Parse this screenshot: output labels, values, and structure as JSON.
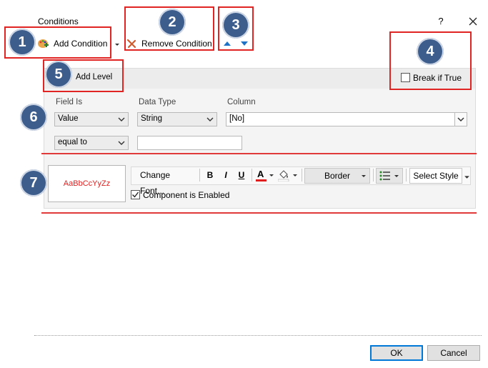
{
  "window": {
    "title": "Conditions",
    "help_label": "?",
    "close_icon": "close-icon"
  },
  "toolbar": {
    "add_condition_label": "Add Condition",
    "remove_condition_label": "Remove Condition",
    "add_icon": "palette-add-icon",
    "remove_icon": "remove-x-icon",
    "move_up_icon": "arrow-up-icon",
    "move_down_icon": "arrow-down-icon"
  },
  "badges": [
    "1",
    "2",
    "3",
    "4",
    "5",
    "6",
    "7"
  ],
  "level": {
    "add_level_label": "Add Level",
    "break_if_true_label": "Break if True",
    "break_if_true_checked": false
  },
  "condition": {
    "field_is_label": "Field Is",
    "data_type_label": "Data Type",
    "column_label": "Column",
    "field_is_value": "Value",
    "data_type_value": "String",
    "column_value": "[No]",
    "operator_value": "equal to",
    "compare_value": ""
  },
  "format": {
    "preview_text": "AaBbCcYyZz",
    "change_font_label": "Change Font...",
    "bold_label": "B",
    "italic_label": "I",
    "underline_label": "U",
    "font_color_label": "A",
    "border_label": "Border",
    "select_style_label": "Select Style",
    "component_enabled_label": "Component is Enabled",
    "component_enabled_checked": true,
    "font_color": "#e01e1e",
    "fill_icon": "paint-bucket-icon",
    "list_icon": "bulleted-list-icon"
  },
  "footer": {
    "ok_label": "OK",
    "cancel_label": "Cancel"
  },
  "colors": {
    "highlight_red": "#e02424",
    "badge_blue": "#3d5d8c",
    "arrow_blue": "#1e73c8"
  }
}
